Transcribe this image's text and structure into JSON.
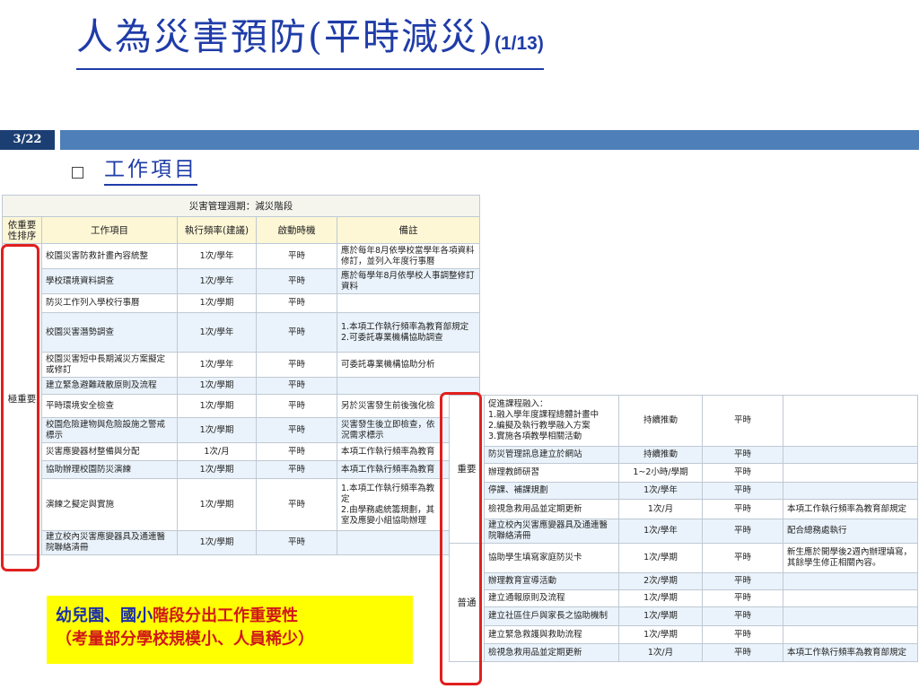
{
  "slide": {
    "title_main": "人為災害預防(平時減災)",
    "title_sub": "(1/13)",
    "page_indicator": "3/22",
    "subtitle": "工作項目"
  },
  "colors": {
    "title": "#1f3ca8",
    "bar_dark": "#1c3f73",
    "bar_light": "#4e7fb8",
    "highlight": "#e0201e",
    "note_bg": "#ffff00"
  },
  "icons": {
    "bullet": "square-bullet-icon"
  },
  "table1": {
    "caption": "災害管理週期：減災階段",
    "headers": [
      "依重要性排序",
      "工作項目",
      "執行頻率(建議)",
      "啟動時機",
      "備註"
    ],
    "level": "極重要",
    "rows": [
      {
        "item": "校園災害防救計畫內容統整",
        "freq": "1次/學年",
        "timing": "平時",
        "note": "應於每年8月依學校當學年各項資料修訂，並列入年度行事曆"
      },
      {
        "item": "學校環境資料調查",
        "freq": "1次/學年",
        "timing": "平時",
        "note": "應於每學年8月依學校人事調整修訂資料"
      },
      {
        "item": "防災工作列入學校行事曆",
        "freq": "1次/學期",
        "timing": "平時",
        "note": ""
      },
      {
        "item": "校園災害潛勢調查",
        "freq": "1次/學年",
        "timing": "平時",
        "note": "1.本項工作執行頻率為教育部規定\n2.可委託專業機構協助調查"
      },
      {
        "item": "校園災害短中長期減災方案擬定或修訂",
        "freq": "1次/學年",
        "timing": "平時",
        "note": "可委託專業機構協助分析"
      },
      {
        "item": "建立緊急避難疏散原則及流程",
        "freq": "1次/學期",
        "timing": "平時",
        "note": ""
      },
      {
        "item": "平時環境安全檢查",
        "freq": "1次/學期",
        "timing": "平時",
        "note": "另於災害發生前後強化檢"
      },
      {
        "item": "校園危險建物與危險設施之警戒標示",
        "freq": "1次/學期",
        "timing": "平時",
        "note": "災害發生後立即檢查，依\n況需求標示"
      },
      {
        "item": "災害應變器材整備與分配",
        "freq": "1次/月",
        "timing": "平時",
        "note": "本項工作執行頻率為教育"
      },
      {
        "item": "協助辦理校園防災演練",
        "freq": "1次/學期",
        "timing": "平時",
        "note": "本項工作執行頻率為教育"
      },
      {
        "item": "演練之擬定與實施",
        "freq": "1次/學期",
        "timing": "平時",
        "note": "1.本項工作執行頻率為教\n定\n2.由學務處統籌規劃，其\n室及應變小組協助辦理"
      },
      {
        "item": "建立校內災害應變器具及通連醫院聯絡清冊",
        "freq": "1次/學期",
        "timing": "平時",
        "note": ""
      }
    ]
  },
  "table2": {
    "level_important": "重要",
    "level_normal": "普通",
    "rows": [
      {
        "item": "促進課程融入：\n1.融入學年度課程總體計畫中\n2.編擬及執行教學融入方案\n3.實施各項教學相關活動",
        "freq": "持續推動",
        "timing": "平時",
        "note": ""
      },
      {
        "item": "防災管理訊息建立於網站",
        "freq": "持續推動",
        "timing": "平時",
        "note": ""
      },
      {
        "item": "辦理教師研習",
        "freq": "1~2小時/學期",
        "timing": "平時",
        "note": ""
      },
      {
        "item": "停課、補課規劃",
        "freq": "1次/學年",
        "timing": "平時",
        "note": ""
      },
      {
        "item": "檢視急救用品並定期更新",
        "freq": "1次/月",
        "timing": "平時",
        "note": "本項工作執行頻率為教育部規定"
      },
      {
        "item": "建立校內災害應變器具及通連醫院聯絡清冊",
        "freq": "1次/學年",
        "timing": "平時",
        "note": "配合總務處執行"
      },
      {
        "item": "協助學生填寫家庭防災卡",
        "freq": "1次/學期",
        "timing": "平時",
        "note": "新生應於開學後2週內辦理填寫，其餘學生修正相關內容。"
      },
      {
        "item": "辦理教育宣導活動",
        "freq": "2次/學期",
        "timing": "平時",
        "note": ""
      },
      {
        "item": "建立通報原則及流程",
        "freq": "1次/學期",
        "timing": "平時",
        "note": ""
      },
      {
        "item": "建立社區住戶與家長之協助機制",
        "freq": "1次/學期",
        "timing": "平時",
        "note": ""
      },
      {
        "item": "建立緊急救護與救助流程",
        "freq": "1次/學期",
        "timing": "平時",
        "note": ""
      },
      {
        "item": "檢視急救用品並定期更新",
        "freq": "1次/月",
        "timing": "平時",
        "note": "本項工作執行頻率為教育部規定"
      }
    ]
  },
  "note": {
    "line1_blue": "幼兒園、國小",
    "line1_red": "階段分出工作重要性",
    "line2": "（考量部分學校規模小、人員稀少）"
  }
}
